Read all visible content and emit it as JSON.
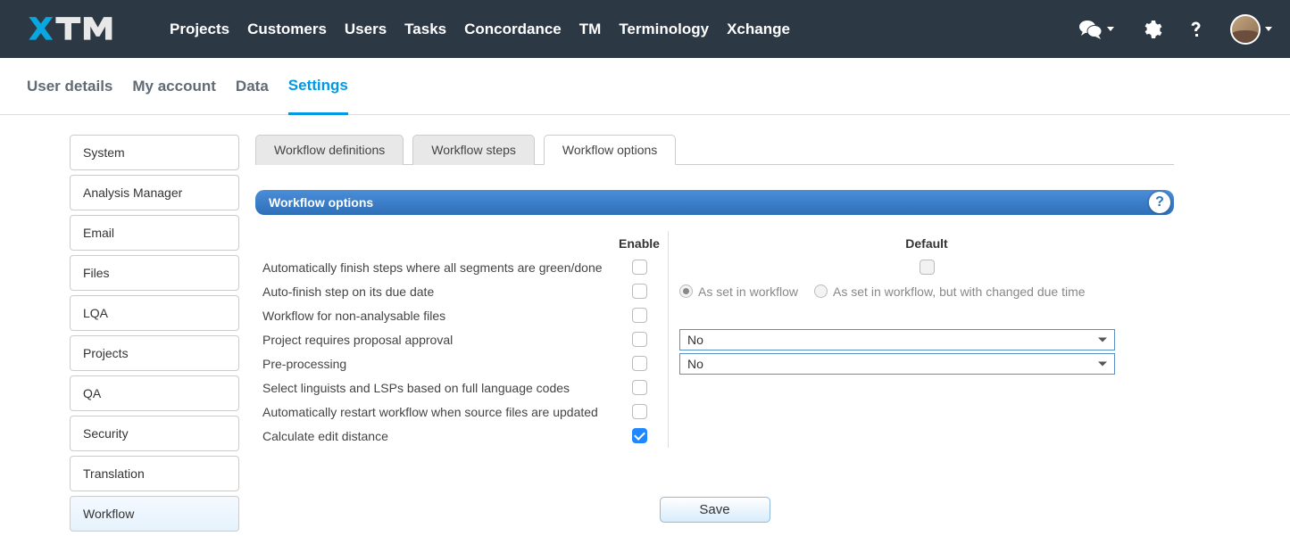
{
  "topnav": {
    "items": [
      "Projects",
      "Customers",
      "Users",
      "Tasks",
      "Concordance",
      "TM",
      "Terminology",
      "Xchange"
    ]
  },
  "subnav": {
    "items": [
      "User details",
      "My account",
      "Data",
      "Settings"
    ],
    "active_index": 3
  },
  "sidebar": {
    "items": [
      "System",
      "Analysis Manager",
      "Email",
      "Files",
      "LQA",
      "Projects",
      "QA",
      "Security",
      "Translation",
      "Workflow"
    ],
    "active_index": 9
  },
  "tabs": {
    "items": [
      "Workflow definitions",
      "Workflow steps",
      "Workflow options"
    ],
    "active_index": 2
  },
  "panel": {
    "title": "Workflow options"
  },
  "headers": {
    "enable": "Enable",
    "default": "Default"
  },
  "rows": [
    {
      "label": "Automatically finish steps where all segments are green/done"
    },
    {
      "label": "Auto-finish step on its due date"
    },
    {
      "label": "Workflow for non-analysable files"
    },
    {
      "label": "Project requires proposal approval"
    },
    {
      "label": "Pre-processing"
    },
    {
      "label": "Select linguists and LSPs based on full language codes"
    },
    {
      "label": "Automatically restart workflow when source files are updated"
    },
    {
      "label": "Calculate edit distance"
    }
  ],
  "radio_options": {
    "as_set": "As set in workflow",
    "as_set_changed": "As set in workflow, but with changed due time"
  },
  "selects": {
    "proposal_approval": "No",
    "pre_processing": "No"
  },
  "save_label": "Save"
}
